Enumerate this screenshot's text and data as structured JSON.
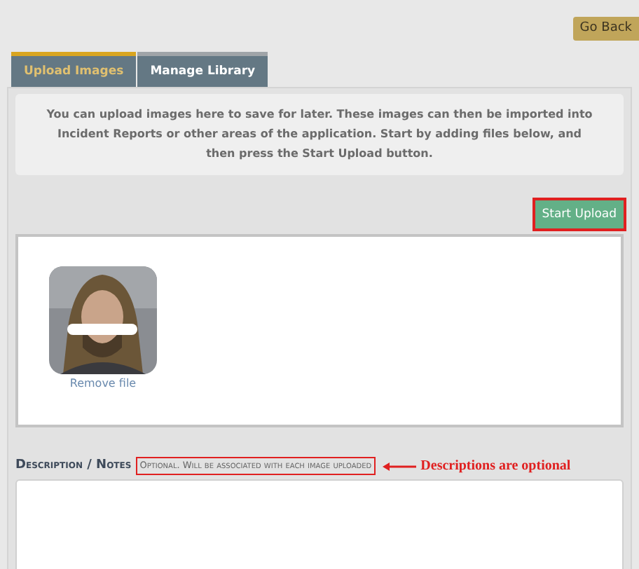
{
  "go_back": "Go Back",
  "tabs": [
    {
      "label": "Upload Images",
      "selected": true
    },
    {
      "label": "Manage Library",
      "selected": false
    }
  ],
  "info": "You can upload images here to save for later. These images can then be imported into Incident Reports or other areas of the application. Start by adding files below, and then press the Start Upload button.",
  "start_upload": {
    "label": "Start Upload",
    "highlighted": true
  },
  "files": [
    {
      "kind": "picture",
      "remove": "Remove file"
    }
  ],
  "description": {
    "label": "Description / Notes",
    "hint": "Optional. Will be associated with each image uploaded",
    "hint_highlighted": true
  },
  "annotation": "Descriptions are optional"
}
